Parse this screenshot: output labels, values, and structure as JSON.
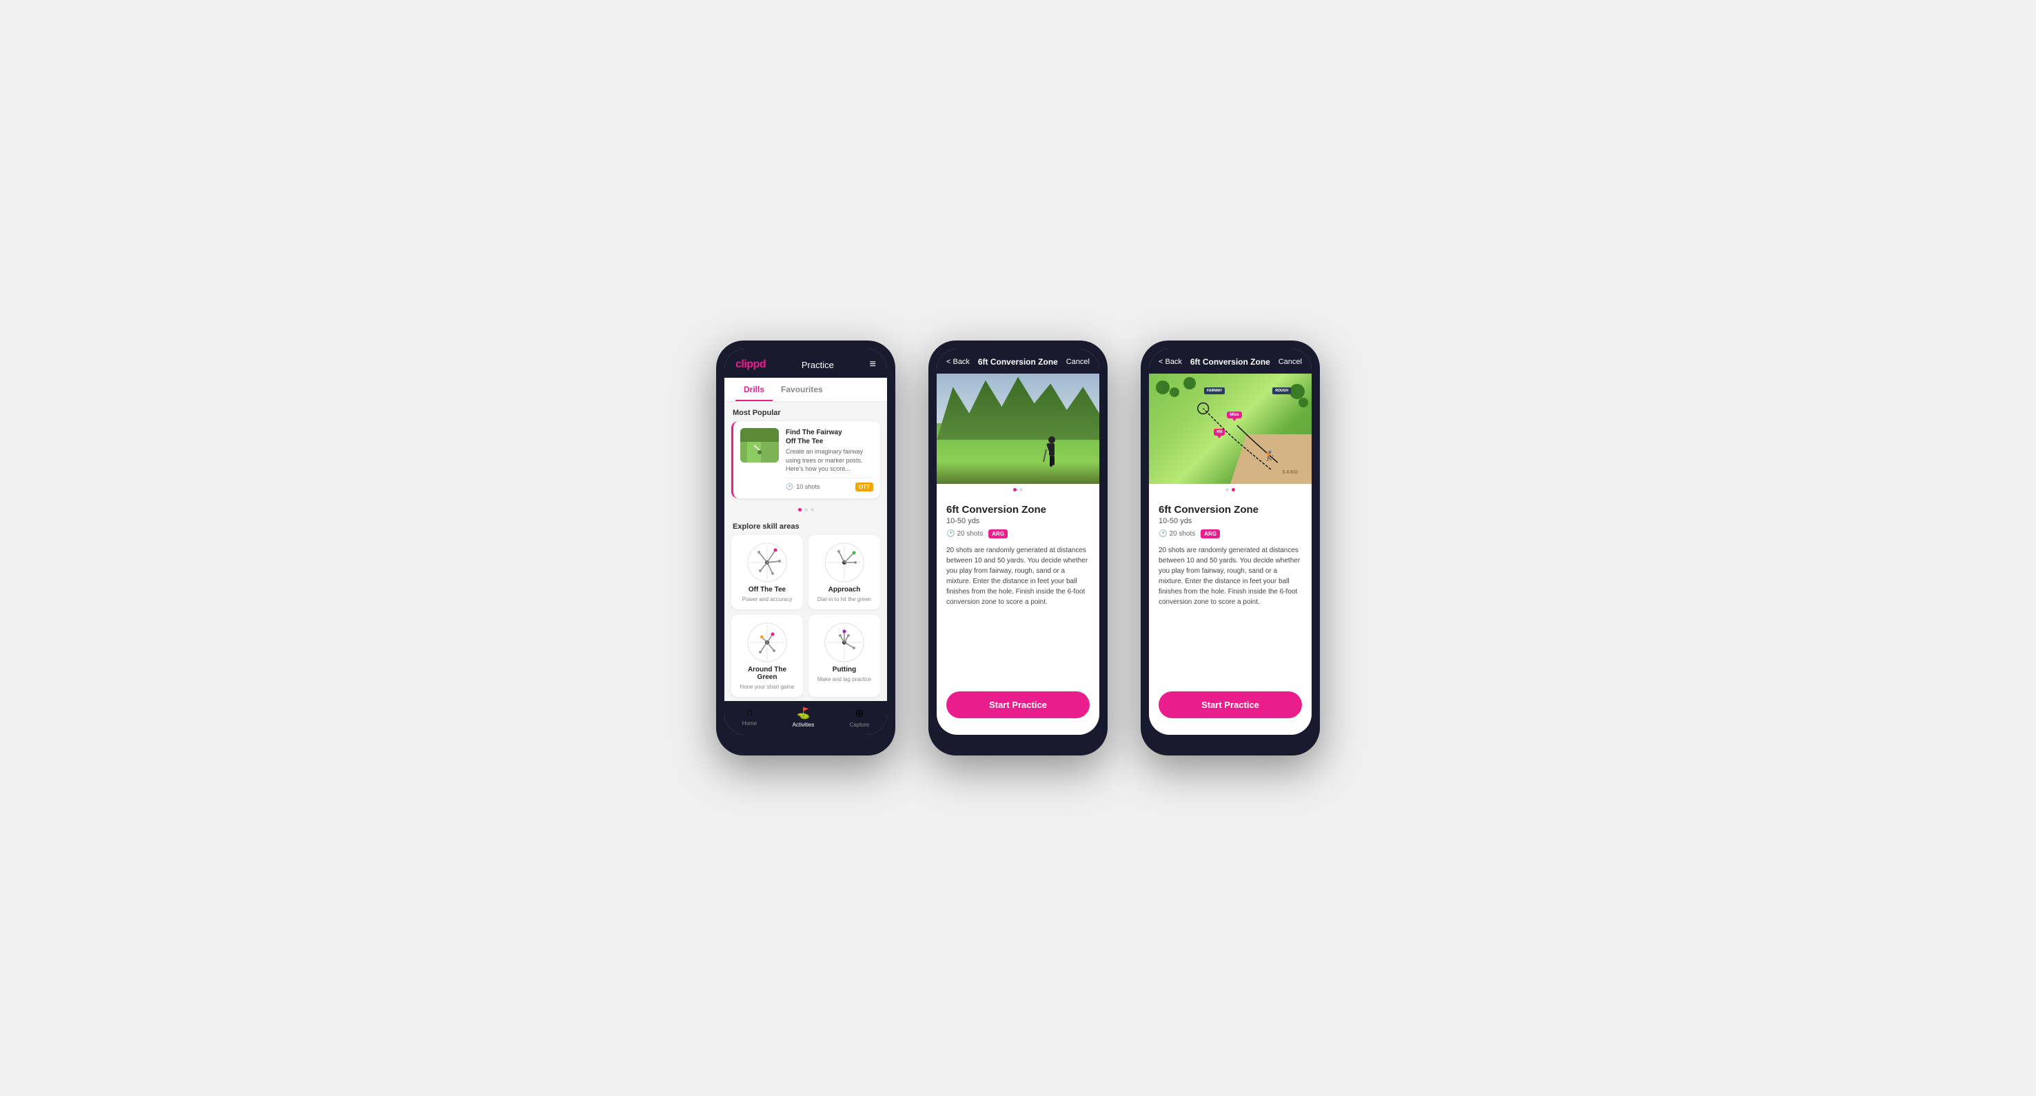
{
  "phones": {
    "phone1": {
      "logo": "clippd",
      "header_title": "Practice",
      "menu_icon": "≡",
      "tabs": [
        {
          "label": "Drills",
          "active": true
        },
        {
          "label": "Favourites",
          "active": false
        }
      ],
      "most_popular_label": "Most Popular",
      "drill_card": {
        "title": "Find The Fairway",
        "subtitle": "Off The Tee",
        "description": "Create an imaginary fairway using trees or marker posts. Here's how you score...",
        "shots_label": "10 shots",
        "tag": "OTT"
      },
      "explore_label": "Explore skill areas",
      "skill_areas": [
        {
          "name": "Off The Tee",
          "desc": "Power and accuracy"
        },
        {
          "name": "Approach",
          "desc": "Dial-in to hit the green"
        },
        {
          "name": "Around The Green",
          "desc": "Hone your short game"
        },
        {
          "name": "Putting",
          "desc": "Make and lag practice"
        }
      ],
      "nav": [
        {
          "label": "Home",
          "icon": "⌂",
          "active": false
        },
        {
          "label": "Activities",
          "icon": "⛳",
          "active": true
        },
        {
          "label": "Capture",
          "icon": "⊕",
          "active": false
        }
      ]
    },
    "phone2": {
      "back_label": "< Back",
      "header_title": "6ft Conversion Zone",
      "cancel_label": "Cancel",
      "drill_title": "6ft Conversion Zone",
      "drill_subtitle": "10-50 yds",
      "shots_label": "20 shots",
      "tag": "ARG",
      "description": "20 shots are randomly generated at distances between 10 and 50 yards. You decide whether you play from fairway, rough, sand or a mixture. Enter the distance in feet your ball finishes from the hole. Finish inside the 6-foot conversion zone to score a point.",
      "start_button": "Start Practice"
    },
    "phone3": {
      "back_label": "< Back",
      "header_title": "6ft Conversion Zone",
      "cancel_label": "Cancel",
      "drill_title": "6ft Conversion Zone",
      "drill_subtitle": "10-50 yds",
      "shots_label": "20 shots",
      "tag": "ARG",
      "description": "20 shots are randomly generated at distances between 10 and 50 yards. You decide whether you play from fairway, rough, sand or a mixture. Enter the distance in feet your ball finishes from the hole. Finish inside the 6-foot conversion zone to score a point.",
      "start_button": "Start Practice",
      "map_labels": {
        "fairway": "FAIRWAY",
        "rough": "ROUGH",
        "miss": "Miss",
        "hit": "Hit",
        "sand": "SAND"
      }
    }
  }
}
